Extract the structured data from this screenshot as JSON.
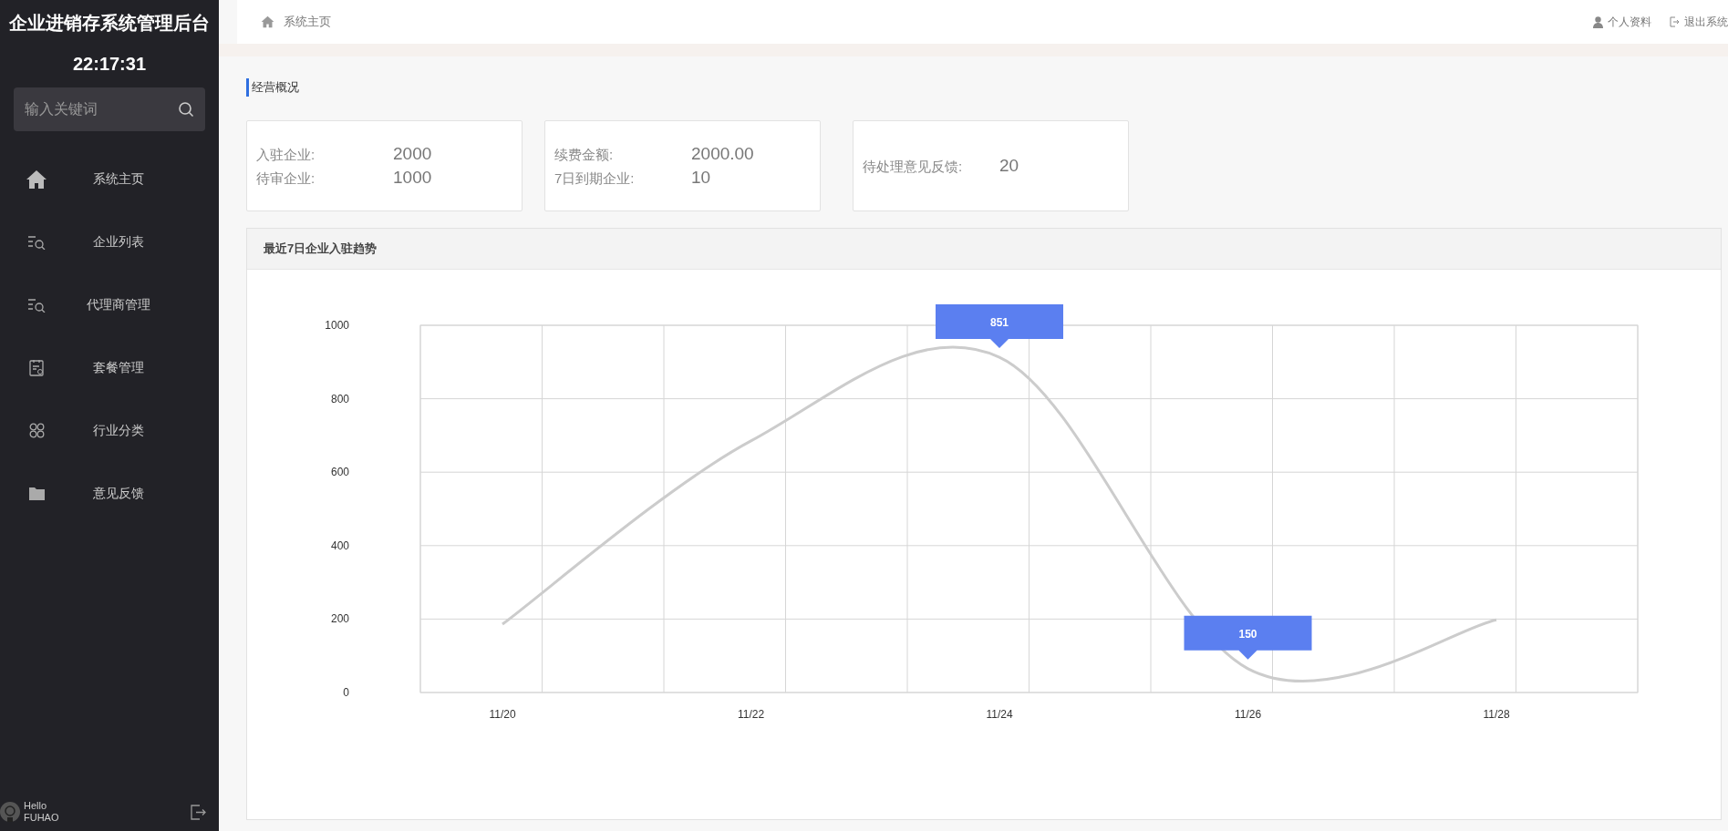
{
  "sidebar": {
    "title": "企业进销存系统管理后台",
    "clock": "22:17:31",
    "search": {
      "placeholder": "输入关键词"
    },
    "items": [
      {
        "label": "系统主页"
      },
      {
        "label": "企业列表"
      },
      {
        "label": "代理商管理"
      },
      {
        "label": "套餐管理"
      },
      {
        "label": "行业分类"
      },
      {
        "label": "意见反馈"
      }
    ],
    "user": {
      "greeting": "Hello",
      "name": "FUHAO"
    }
  },
  "topbar": {
    "breadcrumb": "系统主页",
    "links": [
      {
        "label": "个人资料"
      },
      {
        "label": "退出系统"
      }
    ]
  },
  "section_title": "经营概况",
  "stat_cards": [
    {
      "rows": [
        {
          "label": "入驻企业:",
          "value": "2000"
        },
        {
          "label": "待审企业:",
          "value": "1000"
        }
      ]
    },
    {
      "rows": [
        {
          "label": "续费金额:",
          "value": "2000.00"
        },
        {
          "label": "7日到期企业:",
          "value": "10"
        }
      ]
    },
    {
      "rows": [
        {
          "label": "待处理意见反馈:",
          "value": "20"
        }
      ]
    }
  ],
  "chart_panel": {
    "title": "最近7日企业入驻趋势",
    "chart_data": {
      "type": "line",
      "categories": [
        "11/20",
        "11/22",
        "11/24",
        "11/26",
        "11/28"
      ],
      "series": [
        {
          "color": "#cccccc",
          "values": [
            186,
            685,
            913,
            65,
            198
          ]
        }
      ],
      "ylim": [
        0,
        1000
      ],
      "yticks": [
        0,
        200,
        400,
        600,
        800,
        1000
      ],
      "grid": true,
      "annotations": [
        "851",
        "150"
      ]
    }
  }
}
